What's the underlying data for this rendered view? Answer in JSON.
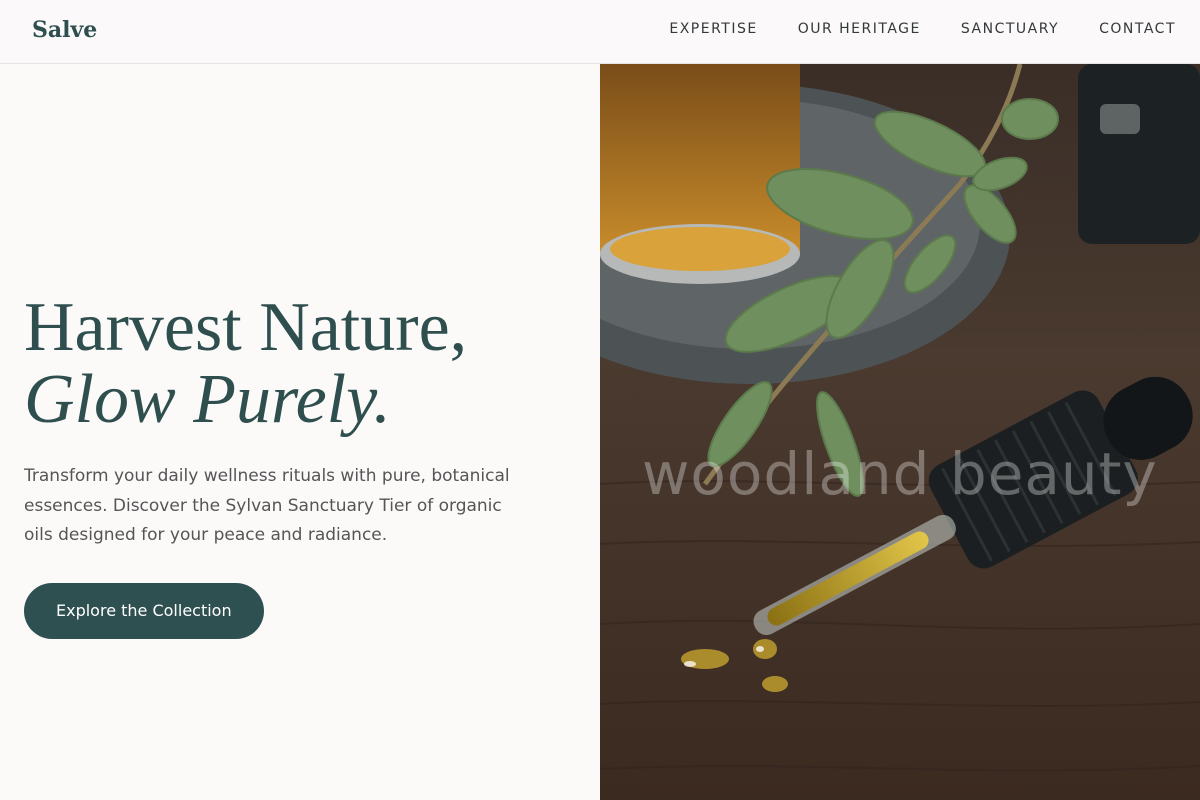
{
  "brand": {
    "name": "Salve"
  },
  "nav": {
    "items": [
      "EXPERTISE",
      "OUR HERITAGE",
      "SANCTUARY",
      "CONTACT"
    ]
  },
  "hero": {
    "title_line1": "Harvest Nature,",
    "title_line2": "Glow Purely.",
    "description": "Transform your daily wellness rituals with pure, botanical essences. Discover the Sylvan Sanctuary Tier of organic oils designed for your peace and radiance.",
    "cta_label": "Explore the Collection",
    "image_watermark": "woodland beauty"
  },
  "colors": {
    "brand_green": "#2f4f4f",
    "button": "#2f5051",
    "background": "#fcf9f9"
  }
}
